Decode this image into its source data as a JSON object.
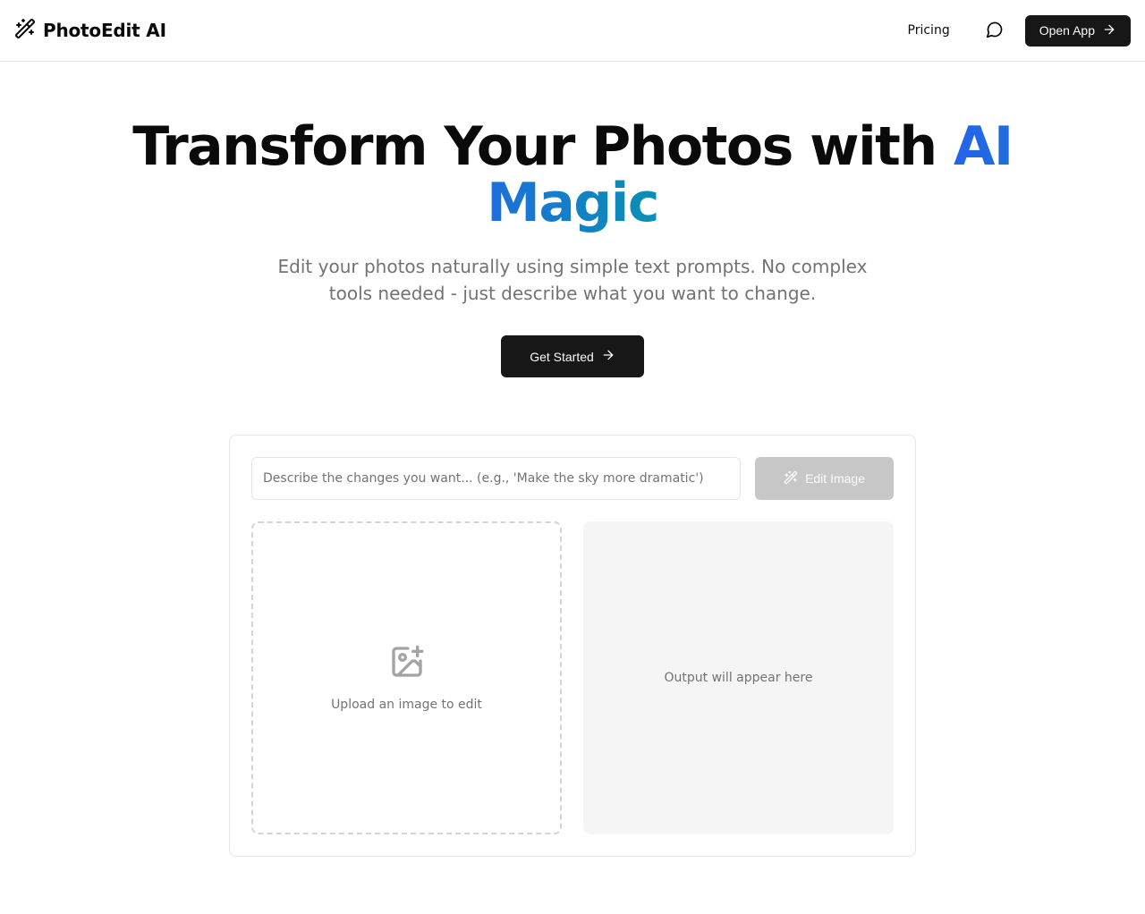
{
  "header": {
    "brand": "PhotoEdit AI",
    "nav": {
      "pricing": "Pricing"
    },
    "cta": "Open App"
  },
  "hero": {
    "title_prefix": "Transform Your Photos with ",
    "title_accent": "AI Magic",
    "subtitle": "Edit your photos naturally using simple text prompts. No complex tools needed - just describe what you want to change.",
    "cta": "Get Started"
  },
  "editor": {
    "prompt_placeholder": "Describe the changes you want... (e.g., 'Make the sky more dramatic')",
    "edit_button": "Edit Image",
    "upload_prompt": "Upload an image to edit",
    "output_placeholder": "Output will appear here"
  }
}
